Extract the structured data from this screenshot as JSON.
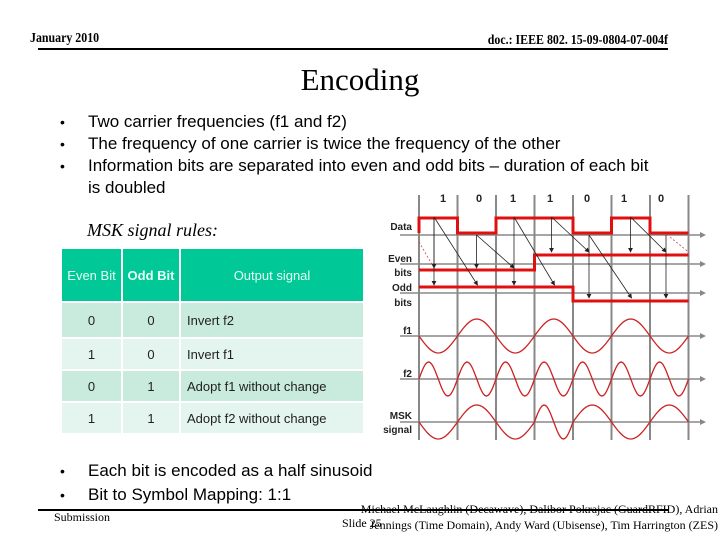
{
  "header": {
    "date": "January 2010",
    "doc_id": "doc.: IEEE 802. 15-09-0804-07-004f"
  },
  "title": "Encoding",
  "bullets": [
    "Two carrier frequencies (f1 and f2)",
    "The frequency of one carrier is twice the frequency of the other",
    "Information bits are separated into even and odd bits – duration of each bit is doubled"
  ],
  "rules_heading": "MSK signal rules:",
  "rules_table": {
    "headers": [
      "Even Bit",
      "Odd Bit",
      "Output signal"
    ],
    "rows": [
      [
        "0",
        "0",
        "Invert  f2"
      ],
      [
        "1",
        "0",
        "Invert  f1"
      ],
      [
        "0",
        "1",
        "Adopt  f1 without change"
      ],
      [
        "1",
        "1",
        "Adopt  f2 without change"
      ]
    ]
  },
  "diagram": {
    "data_bits": [
      "1",
      "0",
      "1",
      "1",
      "0",
      "1",
      "0"
    ],
    "row_labels": {
      "data": "Data",
      "even1": "Even",
      "even2": "bits",
      "odd1": "Odd",
      "odd2": "bits",
      "f1": "f1",
      "f2": "f2",
      "msk1": "MSK",
      "msk2": "signal"
    },
    "even_bits": [
      1,
      1,
      0,
      0
    ],
    "odd_bits": [
      1,
      1,
      1,
      0
    ],
    "msk_segments": [
      "f1-neg",
      "f1-pos",
      "f1-neg",
      "f2-pos",
      "f1-pos",
      "f1-neg",
      "f1-pos"
    ],
    "colors": {
      "signal": "#e01010",
      "grid": "#888888",
      "wave": "#cc2222"
    }
  },
  "bottom_bullets": [
    "Each bit is encoded as a half sinusoid",
    "Bit to Symbol Mapping: 1:1"
  ],
  "footer": {
    "submission": "Submission",
    "slide": "Slide 25",
    "authors_line1": "Michael McLaughlin (Decawave), Dalibor Pokrajac (GuardRFID), Adrian",
    "authors_line2": "Jennings (Time Domain), Andy Ward (Ubisense), Tim Harrington (ZES)"
  }
}
